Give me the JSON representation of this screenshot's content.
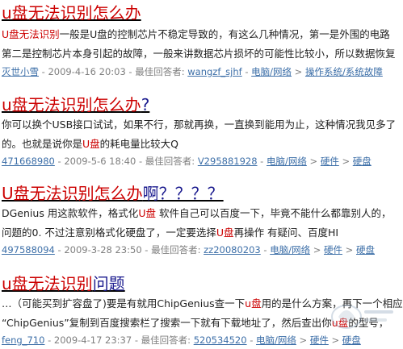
{
  "results": [
    {
      "title_hl": "u盘无法识别怎么办",
      "title_rest": "",
      "line1": [
        {
          "hl": true,
          "t": "U盘无法识别"
        },
        {
          "hl": false,
          "t": "一般是U盘的控制芯片不稳定导致的，有这么几种情况，第一是外围的电路"
        }
      ],
      "line2": [
        {
          "hl": false,
          "t": "第二是控制芯片本身引起的故障，一般来讲数据芯片损坏的可能性比较小，所以数据恢复"
        }
      ],
      "meta": {
        "user": "灭世小雪",
        "date": " - 2009-4-16 20:03 - 最佳回答者: ",
        "answerer": "wangzf_sjhf",
        "sep1": " - ",
        "cat1": "电脑/网络",
        "sep2": " > ",
        "cat2": "操作系统/系统故障",
        "sep3": "",
        "cat3": ""
      }
    },
    {
      "title_hl": "u盘无法识别怎么办",
      "title_rest": "?",
      "line1": [
        {
          "hl": false,
          "t": "你可以换个USB接口试试，如果不行，那就再换，一直换到能用为止，这种情况我见多了"
        }
      ],
      "line2": [
        {
          "hl": false,
          "t": "的。也就是说你是"
        },
        {
          "hl": true,
          "t": "U盘"
        },
        {
          "hl": false,
          "t": "的耗电量比较大Q"
        }
      ],
      "meta": {
        "user": "471668980",
        "date": " - 2009-5-6 18:40 - 最佳回答者: ",
        "answerer": "V295881928",
        "sep1": " - ",
        "cat1": "电脑/网络",
        "sep2": " > ",
        "cat2": "硬件",
        "sep3": " > ",
        "cat3": "硬盘"
      }
    },
    {
      "title_hl": "U盘无法识别怎么办",
      "title_rest": "啊？？？？",
      "line1": [
        {
          "hl": false,
          "t": "DGenius 用这款软件，格式化"
        },
        {
          "hl": true,
          "t": "U盘"
        },
        {
          "hl": false,
          "t": " 软件自己可以百度一下，毕竟不能什么都靠别人的，"
        }
      ],
      "line2": [
        {
          "hl": false,
          "t": "问题的0. 不过注意别格式化硬盘了，一定要选择"
        },
        {
          "hl": true,
          "t": "U盘"
        },
        {
          "hl": false,
          "t": "再操作  有疑问、百度HI"
        }
      ],
      "meta": {
        "user": "497588094",
        "date": " - 2009-3-28 23:50 - 最佳回答者: ",
        "answerer": "zz20080203",
        "sep1": " - ",
        "cat1": "电脑/网络",
        "sep2": " > ",
        "cat2": "硬件",
        "sep3": " > ",
        "cat3": "硬盘"
      }
    },
    {
      "title_hl": "u盘无法识别",
      "title_rest": "问题",
      "line1": [
        {
          "hl": false,
          "t": "…（可能买到扩容盘了)要是有就用ChipGenius查一下"
        },
        {
          "hl": true,
          "t": "u盘"
        },
        {
          "hl": false,
          "t": "用的是什么方案，再下一个相应"
        }
      ],
      "line2": [
        {
          "hl": false,
          "t": "“ChipGenius”复制到百度搜索栏了搜索一下就有下载地址了，然后查出你"
        },
        {
          "hl": true,
          "t": "u盘"
        },
        {
          "hl": false,
          "t": "的型号，"
        }
      ],
      "meta": {
        "user": "feng_710",
        "date": " - 2009-4-17 23:37 - 最佳回答者: ",
        "answerer": "520534520",
        "sep1": " - ",
        "cat1": "电脑/网络",
        "sep2": " > ",
        "cat2": "硬件",
        "sep3": " > ",
        "cat3": "硬盘"
      }
    }
  ],
  "colors": {
    "highlight": "#cc0000",
    "title": "#1a1a8e",
    "link": "#3d6fa8",
    "meta": "#7f7f7f"
  },
  "watermark_icon": "site-logo-watermark"
}
